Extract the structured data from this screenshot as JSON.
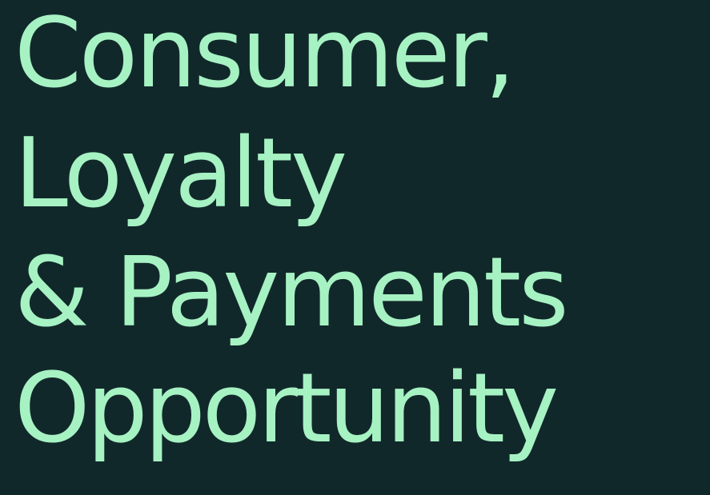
{
  "slide": {
    "title_lines": [
      "Consumer,",
      "Loyalty",
      "& Payments",
      "Opportunity"
    ],
    "text_color": "#a6f2c3",
    "background_color": "#11282a"
  }
}
